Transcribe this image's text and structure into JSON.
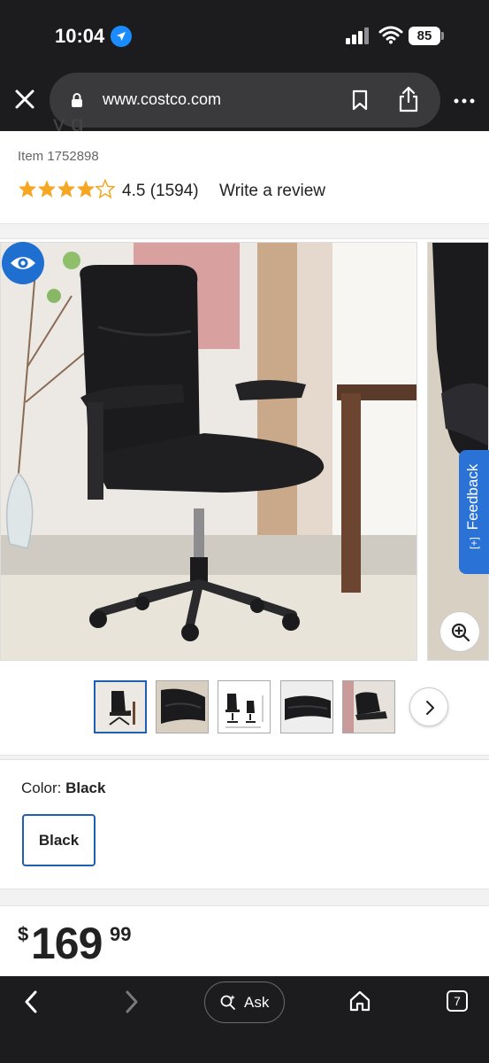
{
  "status_bar": {
    "time": "10:04",
    "battery": "85"
  },
  "browser": {
    "url": "www.costco.com"
  },
  "product": {
    "title_fragment": "y    g",
    "item_number": "Item 1752898",
    "rating": 4.5,
    "rating_text": "4.5 (1594)",
    "review_link": "Write a review"
  },
  "gallery": {
    "feedback_label": "Feedback",
    "feedback_icon_text": "[+]",
    "thumbnail_count": 5,
    "active_thumbnail": 1
  },
  "color": {
    "label": "Color:",
    "selected": "Black",
    "options": [
      "Black"
    ]
  },
  "price": {
    "currency": "$",
    "dollars": "169",
    "cents": "99"
  },
  "toolbar": {
    "ask_label": "Ask",
    "tab_count": "7"
  },
  "colors": {
    "accent": "#1f5fb0",
    "star": "#f5a623",
    "dark": "#1c1c1e",
    "feedback": "#2a72d6"
  }
}
